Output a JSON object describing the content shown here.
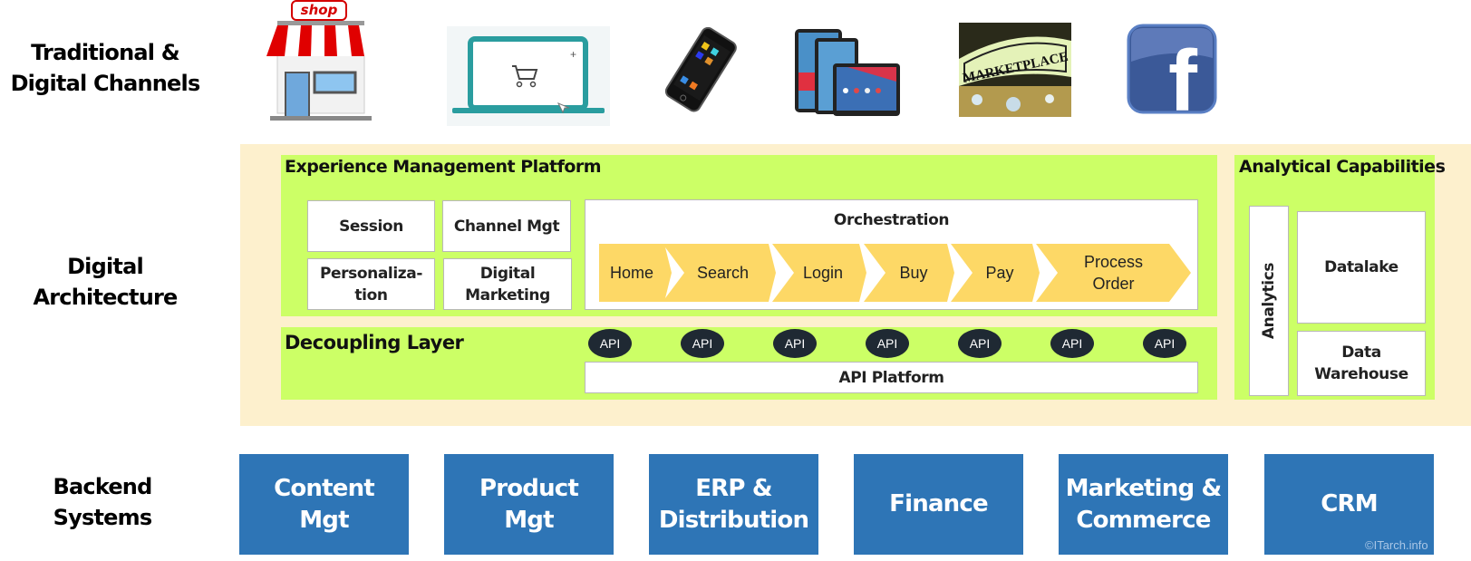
{
  "rows": {
    "channels": [
      "Traditional &",
      "Digital Channels"
    ],
    "architecture": [
      "Digital",
      "Architecture"
    ],
    "backend": [
      "Backend",
      "Systems"
    ]
  },
  "channels": [
    {
      "name": "Physical Shop",
      "icon": "shop-icon",
      "sign_text": "shop"
    },
    {
      "name": "E-commerce Website",
      "icon": "laptop-cart-icon"
    },
    {
      "name": "Mobile Phone",
      "icon": "smartphone-icon"
    },
    {
      "name": "Tablets",
      "icon": "tablets-icon"
    },
    {
      "name": "Marketplace",
      "icon": "marketplace-icon",
      "sign_text": "MARKETPLACE"
    },
    {
      "name": "Facebook",
      "icon": "facebook-icon",
      "glyph": "f"
    }
  ],
  "experience_platform": {
    "title": "Experience Management Platform",
    "boxes": [
      "Session",
      "Channel Mgt",
      "Personaliza-\ntion",
      "Digital\nMarketing"
    ],
    "orchestration": {
      "title": "Orchestration",
      "steps": [
        "Home",
        "Search",
        "Login",
        "Buy",
        "Pay",
        "Process\nOrder"
      ]
    }
  },
  "decoupling_layer": {
    "title": "Decoupling Layer",
    "apis": [
      "API",
      "API",
      "API",
      "API",
      "API",
      "API",
      "API"
    ],
    "platform": "API Platform"
  },
  "analytical": {
    "title": "Analytical Capabilities",
    "analytics": "Analytics",
    "datalake": "Datalake",
    "warehouse": "Data\nWarehouse"
  },
  "backend_systems": [
    "Content\nMgt",
    "Product\nMgt",
    "ERP &\nDistribution",
    "Finance",
    "Marketing &\nCommerce",
    "CRM"
  ],
  "copyright": "©ITarch.info",
  "colors": {
    "band": "#fdf0cd",
    "green": "#ccff66",
    "chevron": "#fdd866",
    "api": "#1f2933",
    "backend": "#2e75b6"
  }
}
